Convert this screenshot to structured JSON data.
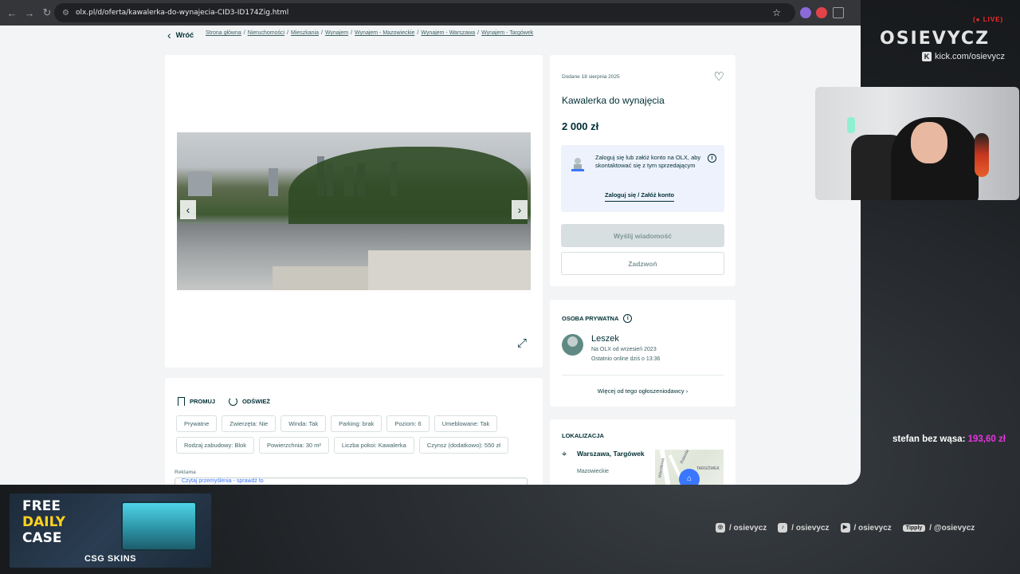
{
  "browser": {
    "url": "olx.pl/d/oferta/kawalerka-do-wynajecia-CID3-ID174Zig.html"
  },
  "page": {
    "back_label": "Wróć",
    "breadcrumb": [
      "Strona główna",
      "Nieruchomości",
      "Mieszkania",
      "Wynajem",
      "Wynajem - Mazowieckie",
      "Wynajem - Warszawa",
      "Wynajem - Targówek"
    ]
  },
  "actions": {
    "promote": "PROMUJ",
    "refresh": "ODŚWIEŻ"
  },
  "tags": [
    "Prywatne",
    "Zwierzęta: Nie",
    "Winda: Tak",
    "Parking: brak",
    "Poziom: 6",
    "Umeblowane: Tak",
    "Rodzaj zabudowy: Blok",
    "Powierzchnia: 30 m²",
    "Liczba pokoi: Kawalerka",
    "Czynsz (dodatkowo): 550 zł"
  ],
  "ad": {
    "label": "Reklama",
    "text": "Czytaj przemyślenia - sprawdź to"
  },
  "offer": {
    "date": "Dodane 18 sierpnia 2025",
    "title": "Kawalerka do wynajęcia",
    "price": "2 000 zł",
    "login_text": "Zaloguj się lub załóż konto na OLX, aby skontaktować się z tym sprzedającym",
    "login_link": "Zaloguj się / Załóż konto",
    "message_button": "Wyślij wiadomość",
    "call_button": "Zadzwoń"
  },
  "seller": {
    "heading": "OSOBA PRYWATNA",
    "name": "Leszek",
    "since": "Na OLX od wrzesień 2023",
    "online": "Ostatnio online dziś o 13:36",
    "more_link": "Więcej od tego ogłoszeniodawcy"
  },
  "location": {
    "heading": "LOKALIZACJA",
    "city": "Warszawa, Targówek",
    "region": "Mazowieckie",
    "map_labels": [
      "Rolanda",
      "TARGÓWEK",
      "Wierzbowa"
    ]
  },
  "overlay": {
    "live": "LIVE",
    "brand": "OSIEVYCZ",
    "kick": "kick.com/osievycz",
    "sub_goal_label": "stefan bez wąsa:",
    "sub_goal_amount": "193,60 zł",
    "promo_free": "FREE",
    "promo_daily": "DAILY",
    "promo_case": "CASE",
    "promo_brand": "CSG SKINS",
    "socials": [
      {
        "icon": "instagram-icon",
        "text": "/ osievycz"
      },
      {
        "icon": "tiktok-icon",
        "text": "/ osievycz"
      },
      {
        "icon": "youtube-icon",
        "text": "/ osievycz"
      },
      {
        "icon": "tipply-icon",
        "badge": "Tipply",
        "text": "/ @osievycz"
      }
    ]
  },
  "colors": {
    "olx_text": "#002f34",
    "login_bg": "#eef2fd",
    "disabled_btn": "#d8dfe0",
    "live_red": "#ff2b2b",
    "goal_pink": "#e535e0"
  }
}
